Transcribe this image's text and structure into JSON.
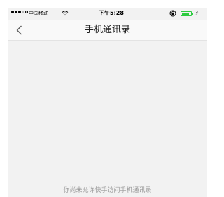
{
  "status_bar": {
    "signal_dots_filled": 3,
    "signal_dots_total": 5,
    "carrier": "中国移动",
    "wifi_icon": "wifi-icon",
    "time": "下午5:28",
    "orientation_icon": "orientation-lock-icon",
    "battery_level": 0.8,
    "charging_symbol": "⚡"
  },
  "nav": {
    "back_icon": "chevron-left-icon",
    "title": "手机通讯录"
  },
  "content": {
    "empty_message": "你尚未允许快手访问手机通讯录"
  }
}
